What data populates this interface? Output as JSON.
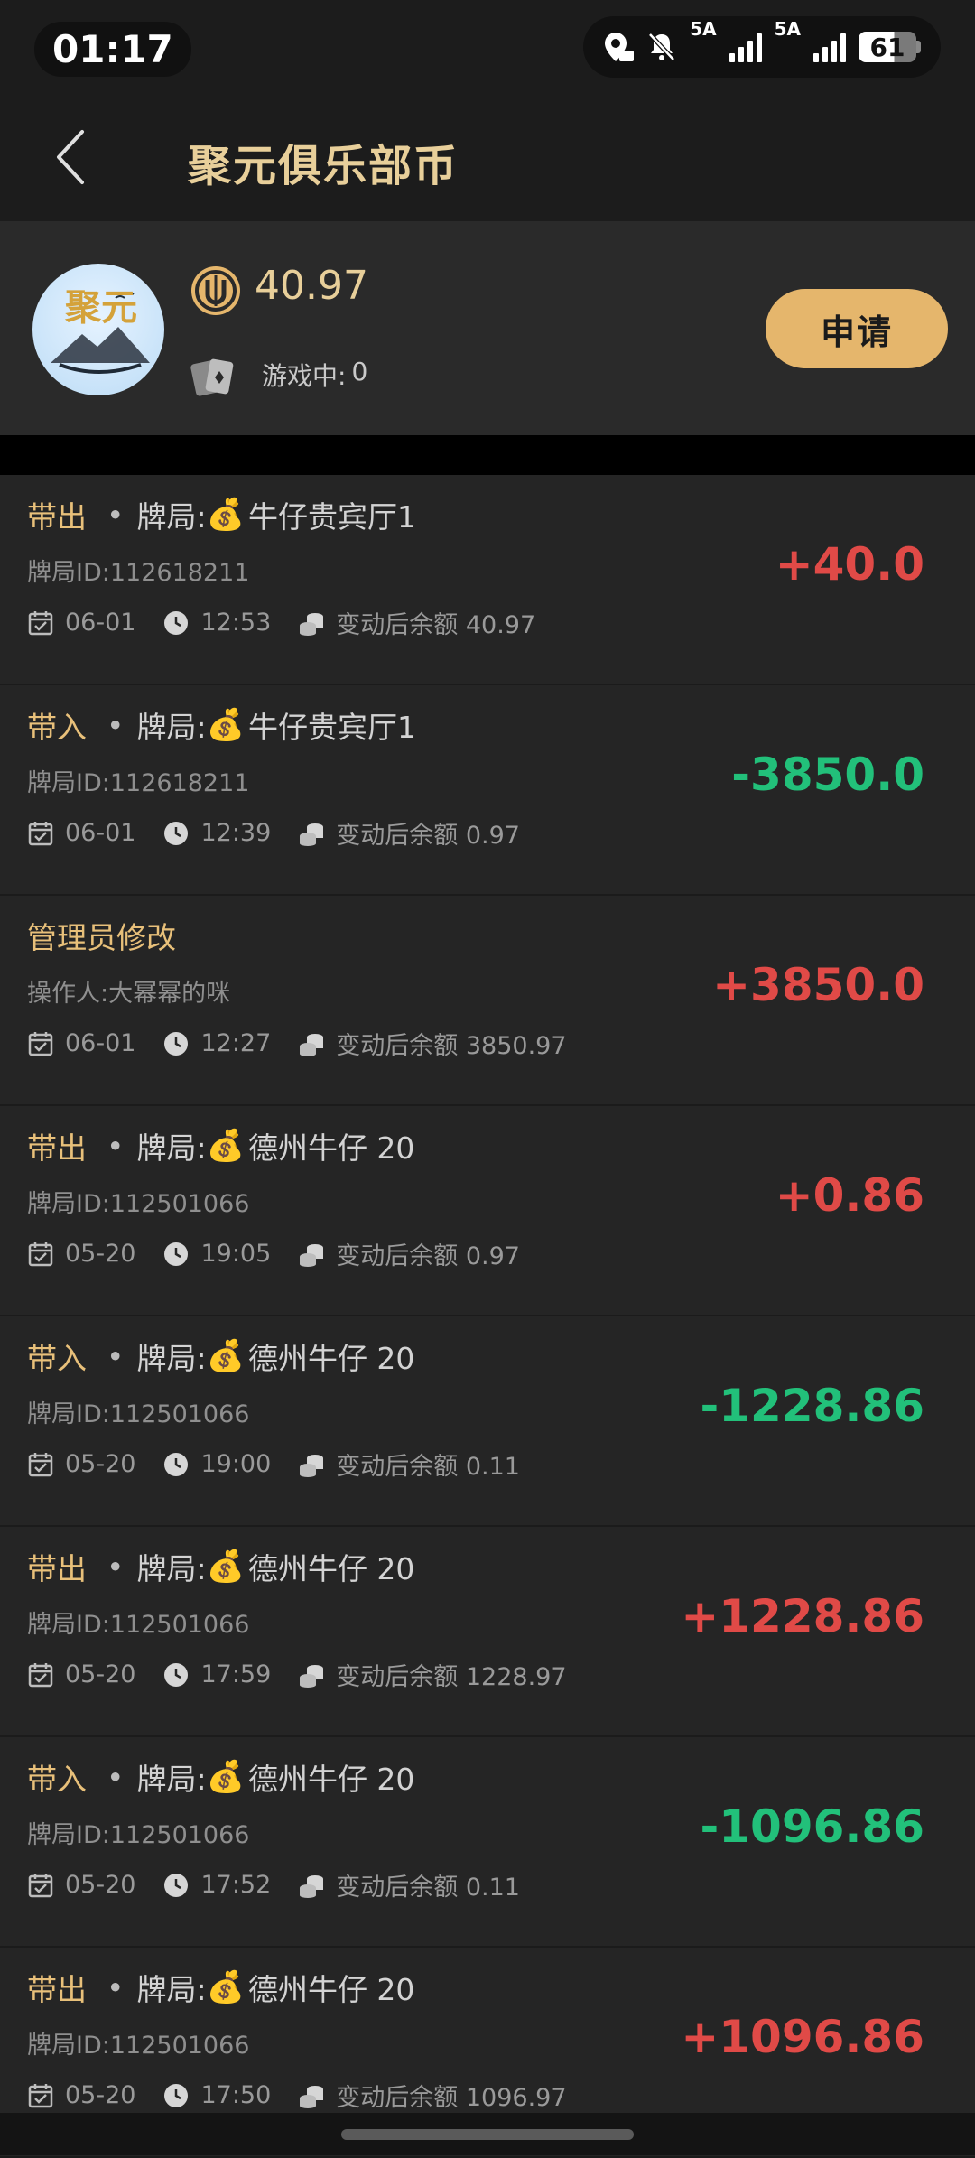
{
  "status": {
    "time": "01:17",
    "net1": "5A",
    "net2": "5A",
    "battery": "61"
  },
  "header": {
    "title": "聚元俱乐部币"
  },
  "profile": {
    "avatar_text": "聚元",
    "coin_balance": "40.97",
    "ingame_label": "游戏中:",
    "ingame_value": "0",
    "apply_label": "申请"
  },
  "colors": {
    "accent_gold": "#e8cf9a",
    "button": "#e5b66c",
    "positive": "#e04a47",
    "negative": "#22c07a"
  },
  "records": [
    {
      "type": "带出",
      "dot": "•",
      "label": "牌局:",
      "bag": "💰",
      "room": "牛仔贵宾厅1",
      "sub": "牌局ID:112618211",
      "date": "06-01",
      "time": "12:53",
      "balance": "变动后余额 40.97",
      "amount": "+40.0",
      "sign": "pos"
    },
    {
      "type": "带入",
      "dot": "•",
      "label": "牌局:",
      "bag": "💰",
      "room": "牛仔贵宾厅1",
      "sub": "牌局ID:112618211",
      "date": "06-01",
      "time": "12:39",
      "balance": "变动后余额 0.97",
      "amount": "-3850.0",
      "sign": "neg"
    },
    {
      "type": "管理员修改",
      "dot": "",
      "label": "",
      "bag": "",
      "room": "",
      "sub": "操作人:大幂幂的咪",
      "date": "06-01",
      "time": "12:27",
      "balance": "变动后余额 3850.97",
      "amount": "+3850.0",
      "sign": "pos"
    },
    {
      "type": "带出",
      "dot": "•",
      "label": "牌局:",
      "bag": "💰",
      "room": "德州牛仔 20",
      "sub": "牌局ID:112501066",
      "date": "05-20",
      "time": "19:05",
      "balance": "变动后余额 0.97",
      "amount": "+0.86",
      "sign": "pos"
    },
    {
      "type": "带入",
      "dot": "•",
      "label": "牌局:",
      "bag": "💰",
      "room": "德州牛仔 20",
      "sub": "牌局ID:112501066",
      "date": "05-20",
      "time": "19:00",
      "balance": "变动后余额 0.11",
      "amount": "-1228.86",
      "sign": "neg"
    },
    {
      "type": "带出",
      "dot": "•",
      "label": "牌局:",
      "bag": "💰",
      "room": "德州牛仔 20",
      "sub": "牌局ID:112501066",
      "date": "05-20",
      "time": "17:59",
      "balance": "变动后余额 1228.97",
      "amount": "+1228.86",
      "sign": "pos"
    },
    {
      "type": "带入",
      "dot": "•",
      "label": "牌局:",
      "bag": "💰",
      "room": "德州牛仔 20",
      "sub": "牌局ID:112501066",
      "date": "05-20",
      "time": "17:52",
      "balance": "变动后余额 0.11",
      "amount": "-1096.86",
      "sign": "neg"
    },
    {
      "type": "带出",
      "dot": "•",
      "label": "牌局:",
      "bag": "💰",
      "room": "德州牛仔 20",
      "sub": "牌局ID:112501066",
      "date": "05-20",
      "time": "17:50",
      "balance": "变动后余额 1096.97",
      "amount": "+1096.86",
      "sign": "pos"
    }
  ]
}
